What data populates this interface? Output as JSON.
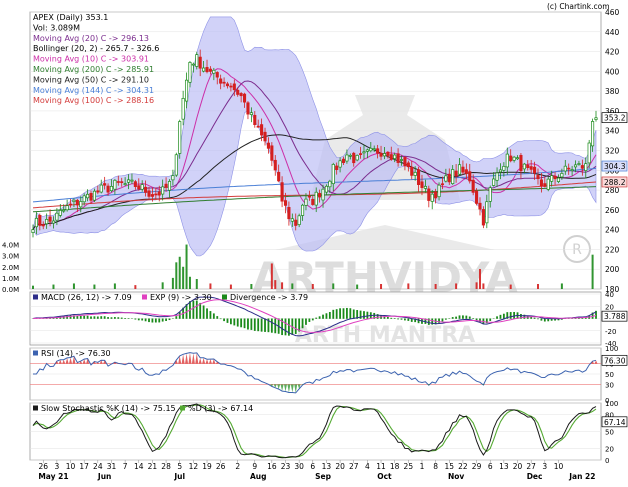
{
  "credit": "(c) Chartink.com",
  "watermark": "ARTHVIDYA",
  "watermark_sub": "ARTH MANTRA",
  "colors": {
    "up": "#1a8a1a",
    "down": "#d41f1f",
    "band": "#b8baf5",
    "grid": "#e3e3e3",
    "sma20": "#7b2d8e",
    "sma10": "#cc2fa8",
    "sma200": "#2f7d2f",
    "sma50": "#222222",
    "sma144": "#4a7fd6",
    "sma100": "#d33b3b",
    "macd": "#2d2d8a",
    "exp": "#e040c0",
    "rsi": "#3c63b0",
    "stochK": "#1a1a1a",
    "stochD": "#55aa33"
  },
  "price_legend": [
    {
      "text": "APEX (Daily) 353.1",
      "color": "#000000"
    },
    {
      "text": "Vol: 3.089M",
      "color": "#000000"
    },
    {
      "text": "Moving Avg (20) C -> 296.13",
      "color": "#7b2d8e"
    },
    {
      "text": "Bollinger (20, 2) - 265.7 - 326.6",
      "color": "#000000"
    },
    {
      "text": "Moving Avg (10) C -> 303.91",
      "color": "#cc2fa8"
    },
    {
      "text": "Moving Avg (200) C -> 285.91",
      "color": "#2f7d2f"
    },
    {
      "text": "Moving Avg (50) C -> 291.10",
      "color": "#222222"
    },
    {
      "text": "Moving Avg (144) C -> 304.31",
      "color": "#4a7fd6"
    },
    {
      "text": "Moving Avg (100) C -> 288.16",
      "color": "#d33b3b"
    }
  ],
  "macd_legend": [
    "MACD (26, 12) -> 7.09",
    "EXP (9) -> 3.30",
    "Divergence -> 3.79"
  ],
  "rsi_legend": "RSI (14) -> 76.30",
  "stoch_legend": [
    "Slow Stochastic %K (14) -> 75.15",
    "%D (3) -> 67.14"
  ],
  "chart_data": {
    "type": "candlestick",
    "price_axis": {
      "ylim": [
        180,
        460
      ],
      "ticks": [
        "180",
        "200",
        "220",
        "240",
        "260",
        "280",
        "300",
        "320",
        "340",
        "360",
        "380",
        "400",
        "420",
        "440",
        "460"
      ]
    },
    "volume_axis": {
      "ylim": [
        0,
        4.5
      ],
      "ticks": [
        "0.0M",
        "1.0M",
        "2.0M",
        "3.0M",
        "4.0M"
      ]
    },
    "price_tags": [
      {
        "label": "353.2",
        "value": 353.2,
        "fill": "#ffffff",
        "stroke": "#000000"
      },
      {
        "label": "304.3",
        "value": 304.3,
        "fill": "#d8dcf8",
        "stroke": "#4a7fd6"
      },
      {
        "label": "288.2",
        "value": 288.2,
        "fill": "#f8d8d8",
        "stroke": "#d33b3b"
      }
    ],
    "macd_axis": {
      "ylim": [
        -40,
        40
      ],
      "ticks": [
        "-40",
        "-20",
        "0",
        "20",
        "40"
      ],
      "tag": "3.788"
    },
    "rsi_axis": {
      "ylim": [
        0,
        100
      ],
      "ticks": [
        "0",
        "30",
        "50",
        "70",
        "100"
      ],
      "tag": "76.30",
      "overbought": 70,
      "oversold": 30
    },
    "stoch_axis": {
      "ylim": [
        0,
        100
      ],
      "ticks": [
        "0",
        "20",
        "50",
        "80",
        "100"
      ],
      "tag": "67.14"
    },
    "x_labels": [
      {
        "i": 3,
        "label": "26"
      },
      {
        "i": 7,
        "label": "3"
      },
      {
        "i": 11,
        "label": "10"
      },
      {
        "i": 15,
        "label": "17"
      },
      {
        "i": 19,
        "label": "24"
      },
      {
        "i": 23,
        "label": "31"
      },
      {
        "i": 27,
        "label": "7"
      },
      {
        "i": 31,
        "label": "14"
      },
      {
        "i": 35,
        "label": "21"
      },
      {
        "i": 39,
        "label": "28"
      },
      {
        "i": 43,
        "label": "5"
      },
      {
        "i": 47,
        "label": "12"
      },
      {
        "i": 51,
        "label": "19"
      },
      {
        "i": 55,
        "label": "26"
      },
      {
        "i": 60,
        "label": "2"
      },
      {
        "i": 65,
        "label": "9"
      },
      {
        "i": 70,
        "label": "16"
      },
      {
        "i": 74,
        "label": "23"
      },
      {
        "i": 78,
        "label": "30"
      },
      {
        "i": 82,
        "label": "6"
      },
      {
        "i": 86,
        "label": "13"
      },
      {
        "i": 90,
        "label": "20"
      },
      {
        "i": 94,
        "label": "27"
      },
      {
        "i": 98,
        "label": "4"
      },
      {
        "i": 102,
        "label": "11"
      },
      {
        "i": 106,
        "label": "18"
      },
      {
        "i": 110,
        "label": "25"
      },
      {
        "i": 114,
        "label": "1"
      },
      {
        "i": 118,
        "label": "8"
      },
      {
        "i": 122,
        "label": "15"
      },
      {
        "i": 126,
        "label": "22"
      },
      {
        "i": 130,
        "label": "29"
      },
      {
        "i": 134,
        "label": "6"
      },
      {
        "i": 138,
        "label": "13"
      },
      {
        "i": 142,
        "label": "20"
      },
      {
        "i": 146,
        "label": "27"
      },
      {
        "i": 150,
        "label": "3"
      },
      {
        "i": 154,
        "label": "10"
      }
    ],
    "month_labels": [
      {
        "i": 6,
        "label": "May 21"
      },
      {
        "i": 21,
        "label": "Jun"
      },
      {
        "i": 43,
        "label": "Jul"
      },
      {
        "i": 66,
        "label": "Aug"
      },
      {
        "i": 85,
        "label": "Sep"
      },
      {
        "i": 103,
        "label": "Oct"
      },
      {
        "i": 124,
        "label": "Nov"
      },
      {
        "i": 147,
        "label": "Dec"
      },
      {
        "i": 161,
        "label": "Jan 22"
      }
    ],
    "close_anchors": [
      [
        0,
        246
      ],
      [
        5,
        248
      ],
      [
        10,
        262
      ],
      [
        14,
        270
      ],
      [
        20,
        280
      ],
      [
        25,
        286
      ],
      [
        30,
        285
      ],
      [
        35,
        276
      ],
      [
        38,
        278
      ],
      [
        41,
        290
      ],
      [
        43,
        352
      ],
      [
        44,
        372
      ],
      [
        46,
        410
      ],
      [
        48,
        412
      ],
      [
        50,
        405
      ],
      [
        52,
        398
      ],
      [
        55,
        392
      ],
      [
        58,
        386
      ],
      [
        61,
        375
      ],
      [
        63,
        360
      ],
      [
        66,
        340
      ],
      [
        69,
        322
      ],
      [
        71,
        298
      ],
      [
        73,
        270
      ],
      [
        75,
        254
      ],
      [
        77,
        246
      ],
      [
        79,
        266
      ],
      [
        82,
        270
      ],
      [
        85,
        282
      ],
      [
        88,
        300
      ],
      [
        92,
        316
      ],
      [
        95,
        310
      ],
      [
        98,
        316
      ],
      [
        101,
        320
      ],
      [
        104,
        320
      ],
      [
        108,
        308
      ],
      [
        111,
        298
      ],
      [
        114,
        284
      ],
      [
        116,
        274
      ],
      [
        119,
        280
      ],
      [
        122,
        294
      ],
      [
        125,
        300
      ],
      [
        128,
        292
      ],
      [
        130,
        270
      ],
      [
        132,
        250
      ],
      [
        134,
        280
      ],
      [
        137,
        306
      ],
      [
        140,
        314
      ],
      [
        143,
        305
      ],
      [
        146,
        295
      ],
      [
        149,
        285
      ],
      [
        152,
        290
      ],
      [
        155,
        298
      ],
      [
        159,
        304
      ],
      [
        162,
        304
      ],
      [
        164,
        353
      ]
    ],
    "volume_bars": [
      [
        0,
        0.3
      ],
      [
        6,
        0.4
      ],
      [
        12,
        0.5
      ],
      [
        18,
        0.4
      ],
      [
        24,
        0.5
      ],
      [
        30,
        0.35
      ],
      [
        38,
        0.6
      ],
      [
        41,
        1.0
      ],
      [
        42,
        2.4
      ],
      [
        43,
        2.9
      ],
      [
        44,
        2.0
      ],
      [
        45,
        4.0
      ],
      [
        46,
        1.1
      ],
      [
        48,
        0.9
      ],
      [
        52,
        0.5
      ],
      [
        58,
        0.4
      ],
      [
        64,
        0.45
      ],
      [
        70,
        2.3
      ],
      [
        71,
        0.8
      ],
      [
        73,
        0.6
      ],
      [
        76,
        0.5
      ],
      [
        82,
        0.45
      ],
      [
        88,
        0.5
      ],
      [
        95,
        0.4
      ],
      [
        102,
        0.45
      ],
      [
        110,
        0.5
      ],
      [
        118,
        0.45
      ],
      [
        124,
        0.5
      ],
      [
        130,
        0.6
      ],
      [
        131,
        1.8
      ],
      [
        132,
        0.5
      ],
      [
        140,
        0.4
      ],
      [
        148,
        0.45
      ],
      [
        155,
        0.5
      ],
      [
        164,
        3.09
      ]
    ]
  }
}
